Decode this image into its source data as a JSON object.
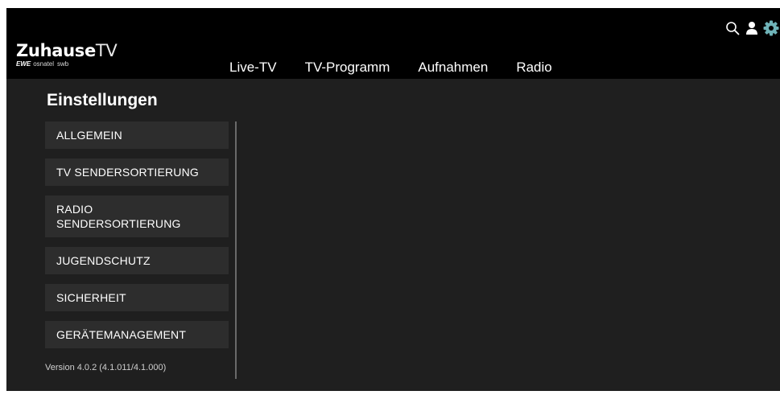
{
  "brand": {
    "name_bold": "Zuhause",
    "name_light": "TV",
    "partner_main": "EWE",
    "partner_1": "osnatel",
    "partner_2": "swb"
  },
  "nav": {
    "items": [
      {
        "label": "Live-TV"
      },
      {
        "label": "TV-Programm"
      },
      {
        "label": "Aufnahmen"
      },
      {
        "label": "Radio"
      }
    ]
  },
  "toolbar": {
    "icons": [
      "search-icon",
      "user-icon",
      "gear-icon"
    ],
    "active_color": "#6fb3b8"
  },
  "settings": {
    "title": "Einstellungen",
    "menu": [
      {
        "label": "ALLGEMEIN"
      },
      {
        "label": "TV SENDERSORTIERUNG"
      },
      {
        "label": "RADIO SENDERSORTIERUNG"
      },
      {
        "label": "JUGENDSCHUTZ"
      },
      {
        "label": "SICHERHEIT"
      },
      {
        "label": "GERÄTEMANAGEMENT"
      }
    ],
    "version": "Version 4.0.2 (4.1.011/4.1.000)"
  },
  "colors": {
    "topbar": "#000000",
    "background": "#1f1f1f",
    "menu_item": "#2d2d2d",
    "text": "#ffffff"
  }
}
